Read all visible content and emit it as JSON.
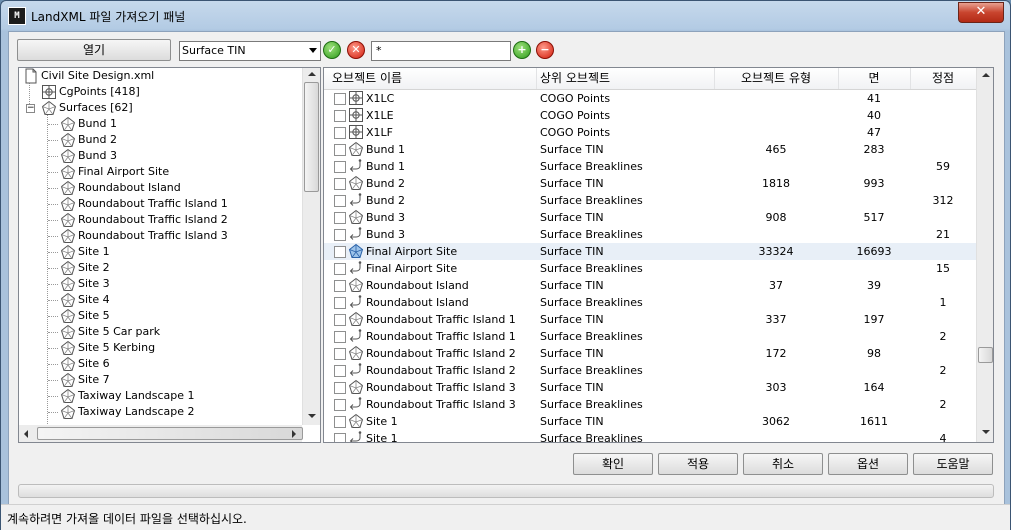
{
  "window": {
    "title": "LandXML 파일 가져오기 패널",
    "close_label": "✕"
  },
  "toolbar": {
    "open_label": "열기",
    "type_select": "Surface TIN",
    "filter_value": "*"
  },
  "tree": {
    "root": "Civil Site Design.xml",
    "cgpoints": "CgPoints [418]",
    "surfaces": "Surfaces [62]",
    "items": [
      "Bund 1",
      "Bund 2",
      "Bund 3",
      "Final Airport Site",
      "Roundabout Island",
      "Roundabout Traffic Island 1",
      "Roundabout Traffic Island 2",
      "Roundabout Traffic Island 3",
      "Site 1",
      "Site 2",
      "Site 3",
      "Site 4",
      "Site 5",
      "Site 5 Car park",
      "Site 5 Kerbing",
      "Site 6",
      "Site 7",
      "Taxiway Landscape 1",
      "Taxiway Landscape 2"
    ]
  },
  "grid": {
    "columns": [
      "오브젝트 이름",
      "상위 오브젝트",
      "오브젝트 유형",
      "면",
      "정점"
    ],
    "rows": [
      {
        "icon": "point",
        "name": "X1LC",
        "parent": "COGO Points",
        "type": "",
        "faces": "41",
        "verts": ""
      },
      {
        "icon": "point",
        "name": "X1LE",
        "parent": "COGO Points",
        "type": "",
        "faces": "40",
        "verts": ""
      },
      {
        "icon": "point",
        "name": "X1LF",
        "parent": "COGO Points",
        "type": "",
        "faces": "47",
        "verts": ""
      },
      {
        "icon": "surface",
        "name": "Bund 1",
        "parent": "Surface TIN",
        "type": "465",
        "faces": "283",
        "verts": ""
      },
      {
        "icon": "breakline",
        "name": "Bund 1",
        "parent": "Surface Breaklines",
        "type": "",
        "faces": "",
        "verts": "59"
      },
      {
        "icon": "surface",
        "name": "Bund 2",
        "parent": "Surface TIN",
        "type": "1818",
        "faces": "993",
        "verts": ""
      },
      {
        "icon": "breakline",
        "name": "Bund 2",
        "parent": "Surface Breaklines",
        "type": "",
        "faces": "",
        "verts": "312"
      },
      {
        "icon": "surface",
        "name": "Bund 3",
        "parent": "Surface TIN",
        "type": "908",
        "faces": "517",
        "verts": ""
      },
      {
        "icon": "breakline",
        "name": "Bund 3",
        "parent": "Surface Breaklines",
        "type": "",
        "faces": "",
        "verts": "21"
      },
      {
        "icon": "surface-blue",
        "name": "Final Airport Site",
        "parent": "Surface TIN",
        "type": "33324",
        "faces": "16693",
        "verts": "",
        "selected": true
      },
      {
        "icon": "breakline",
        "name": "Final Airport Site",
        "parent": "Surface Breaklines",
        "type": "",
        "faces": "",
        "verts": "15"
      },
      {
        "icon": "surface",
        "name": "Roundabout Island",
        "parent": "Surface TIN",
        "type": "37",
        "faces": "39",
        "verts": ""
      },
      {
        "icon": "breakline",
        "name": "Roundabout Island",
        "parent": "Surface Breaklines",
        "type": "",
        "faces": "",
        "verts": "1"
      },
      {
        "icon": "surface",
        "name": "Roundabout Traffic Island 1",
        "parent": "Surface TIN",
        "type": "337",
        "faces": "197",
        "verts": ""
      },
      {
        "icon": "breakline",
        "name": "Roundabout Traffic Island 1",
        "parent": "Surface Breaklines",
        "type": "",
        "faces": "",
        "verts": "2"
      },
      {
        "icon": "surface",
        "name": "Roundabout Traffic Island 2",
        "parent": "Surface TIN",
        "type": "172",
        "faces": "98",
        "verts": ""
      },
      {
        "icon": "breakline",
        "name": "Roundabout Traffic Island 2",
        "parent": "Surface Breaklines",
        "type": "",
        "faces": "",
        "verts": "2"
      },
      {
        "icon": "surface",
        "name": "Roundabout Traffic Island 3",
        "parent": "Surface TIN",
        "type": "303",
        "faces": "164",
        "verts": ""
      },
      {
        "icon": "breakline",
        "name": "Roundabout Traffic Island 3",
        "parent": "Surface Breaklines",
        "type": "",
        "faces": "",
        "verts": "2"
      },
      {
        "icon": "surface",
        "name": "Site 1",
        "parent": "Surface TIN",
        "type": "3062",
        "faces": "1611",
        "verts": ""
      },
      {
        "icon": "breakline",
        "name": "Site 1",
        "parent": "Surface Breaklines",
        "type": "",
        "faces": "",
        "verts": "4"
      }
    ]
  },
  "buttons": {
    "ok": "확인",
    "apply": "적용",
    "cancel": "취소",
    "options": "옵션",
    "help": "도움말"
  },
  "status": "계속하려면 가져올 데이터 파일을 선택하십시오.",
  "colors": {
    "selected_row": "#e8eff7",
    "accent_green": "#2d9a1b",
    "accent_red": "#d11b0b"
  }
}
